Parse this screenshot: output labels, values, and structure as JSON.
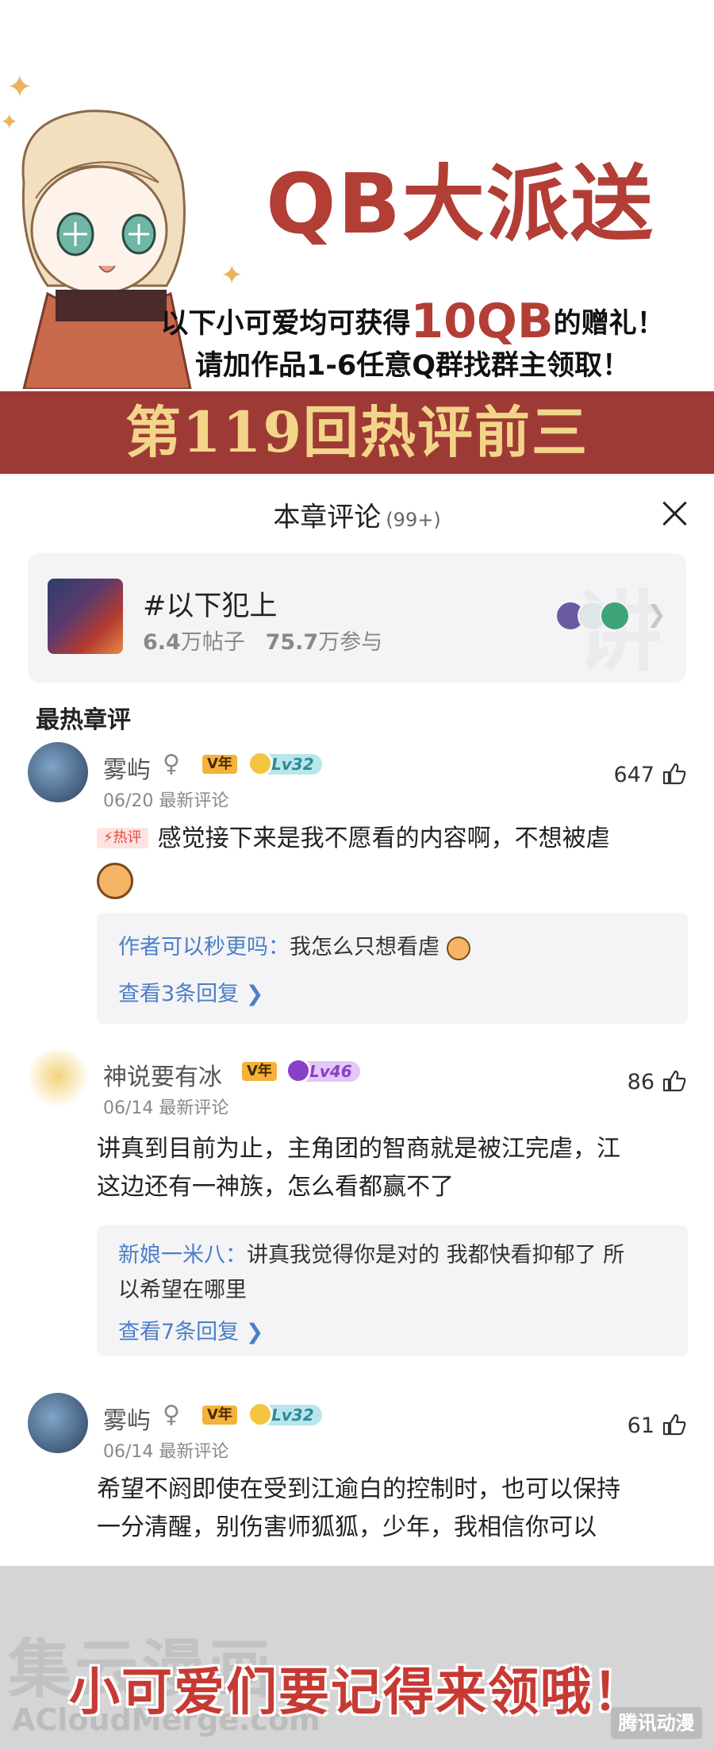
{
  "banner": {
    "title": "QB大派送",
    "line1_pre": "以下小可爱均可获得",
    "line1_big": "10QB",
    "line1_post": "的赠礼！",
    "line2": "请加作品1-6任意Q群找群主领取！",
    "strip_title": "第119回热评前三"
  },
  "panel": {
    "title": "本章评论",
    "count": "(99+)"
  },
  "topic": {
    "name": "#以下犯上",
    "posts_num": "6.4",
    "posts_unit": "万帖子",
    "participants_num": "75.7",
    "participants_unit": "万参与",
    "watermark": "讲"
  },
  "section_label": "最热章评",
  "comments": [
    {
      "user": "雾屿",
      "gender": "♀",
      "vip": "V年",
      "level": "Lv32",
      "date": "06/20",
      "tag": "最新评论",
      "likes": "647",
      "hot_label": "热评",
      "text": "感觉接下来是我不愿看的内容啊，不想被虐",
      "reply_author": "作者可以秒更吗：",
      "reply_text": "我怎么只想看虐",
      "reply_more": "查看3条回复 ❯"
    },
    {
      "user": "神说要有冰",
      "vip": "V年",
      "level": "Lv46",
      "date": "06/14",
      "tag": "最新评论",
      "likes": "86",
      "text_line1": "讲真到目前为止，主角团的智商就是被江完虐，江",
      "text_line2": "这边还有一神族，怎么看都赢不了",
      "reply_author": "新娘一米八：",
      "reply_text1": "讲真我觉得你是对的 我都快看抑郁了 所",
      "reply_text2": "以希望在哪里",
      "reply_more": "查看7条回复 ❯"
    },
    {
      "user": "雾屿",
      "gender": "♀",
      "vip": "V年",
      "level": "Lv32",
      "date": "06/14",
      "tag": "最新评论",
      "likes": "61",
      "text_line1": "希望不阏即使在受到江逾白的控制时，也可以保持",
      "text_line2": "一分清醒，别伤害师狐狐，少年，我相信你可以"
    }
  ],
  "footer": {
    "cta": "小可爱们要记得来领哦！",
    "watermark_cn": "集云漫画",
    "watermark_en": "ACloudMerge.com",
    "logo": "腾讯动漫"
  },
  "colors": {
    "brand_red": "#b23e36",
    "strip_red": "#9e3a35",
    "strip_text": "#f3d58a",
    "link_blue": "#4c7fc7",
    "card_bg": "#f4f4f6"
  },
  "icons": [
    "sparkle-icon",
    "close-icon",
    "chevron-right-icon",
    "like-icon",
    "fire-icon",
    "emoji-icon"
  ]
}
